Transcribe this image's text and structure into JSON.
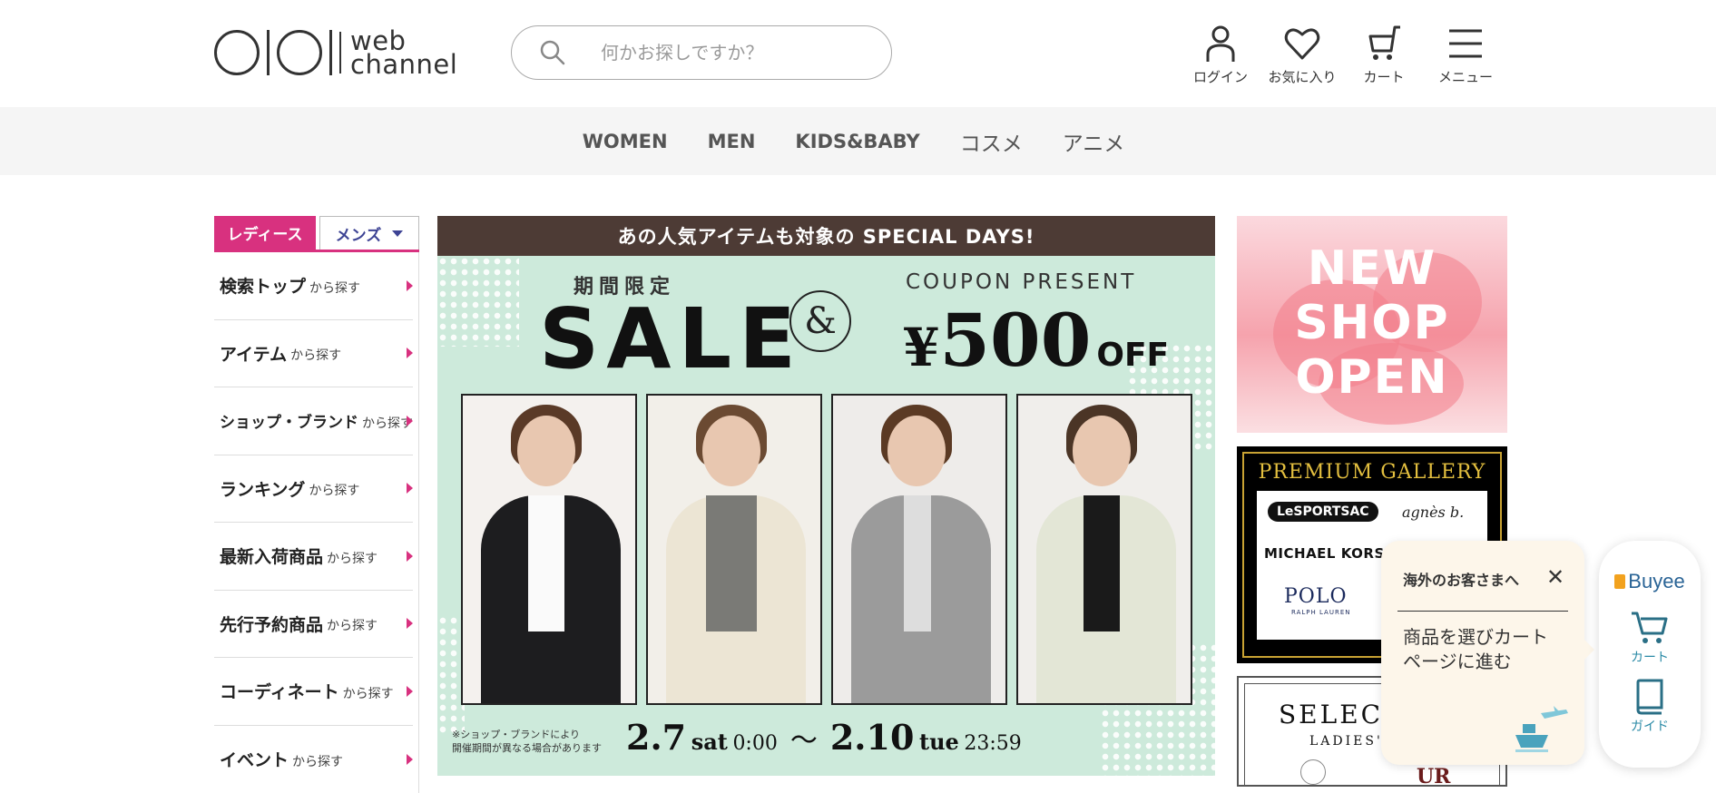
{
  "header": {
    "logo_text_1": "web",
    "logo_text_2": "channel",
    "search_placeholder": "何かお探しですか？",
    "icons": [
      {
        "label": "ログイン",
        "icon": "user-icon"
      },
      {
        "label": "お気に入り",
        "icon": "heart-icon"
      },
      {
        "label": "カート",
        "icon": "cart-icon"
      },
      {
        "label": "メニュー",
        "icon": "menu-icon"
      }
    ]
  },
  "catnav": [
    "WOMEN",
    "MEN",
    "KIDS&BABY",
    "コスメ",
    "アニメ"
  ],
  "sidebar": {
    "tab_ladies": "レディース",
    "tab_mens": "メンズ",
    "items": [
      {
        "main": "検索トップ",
        "sub": "から探す"
      },
      {
        "main": "アイテム",
        "sub": "から探す"
      },
      {
        "main": "ショップ・ブランド",
        "sub": "から探す"
      },
      {
        "main": "ランキング",
        "sub": "から探す"
      },
      {
        "main": "最新入荷商品",
        "sub": "から探す"
      },
      {
        "main": "先行予約商品",
        "sub": "から探す"
      },
      {
        "main": "コーディネート",
        "sub": "から探す"
      },
      {
        "main": "イベント",
        "sub": "から探す"
      }
    ]
  },
  "banner": {
    "top": "あの人気アイテムも対象の SPECIAL DAYS!",
    "kikan": "期間限定",
    "sale": "SALE",
    "amp": "&",
    "coupon": "COUPON PRESENT",
    "yen": "¥",
    "amount": "500",
    "off": "OFF",
    "note_1": "※ショップ・ブランドにより",
    "note_2": "開催期間が異なる場合があります",
    "start_date": "2.7",
    "start_day": "sat",
    "start_time": "0:00",
    "tilde": "～",
    "end_date": "2.10",
    "end_day": "tue",
    "end_time": "23:59"
  },
  "right": {
    "newshop": [
      "NEW",
      "SHOP",
      "OPEN"
    ],
    "premium_title": "PREMIUM GALLERY",
    "brands": [
      "LeSPORTSAC",
      "agnès b.",
      "MICHAEL KORS",
      "POLO",
      "RALPH LAUREN"
    ],
    "select_title": "SELECT",
    "select_sub": "LADIES' &",
    "select_partial": "UR"
  },
  "popup": {
    "title": "海外のお客さまへ",
    "close": "✕",
    "msg_1": "商品を選びカート",
    "msg_2": "ページに進む"
  },
  "buyee": {
    "logo": "Buyee",
    "cart": "カート",
    "guide": "ガイド"
  }
}
